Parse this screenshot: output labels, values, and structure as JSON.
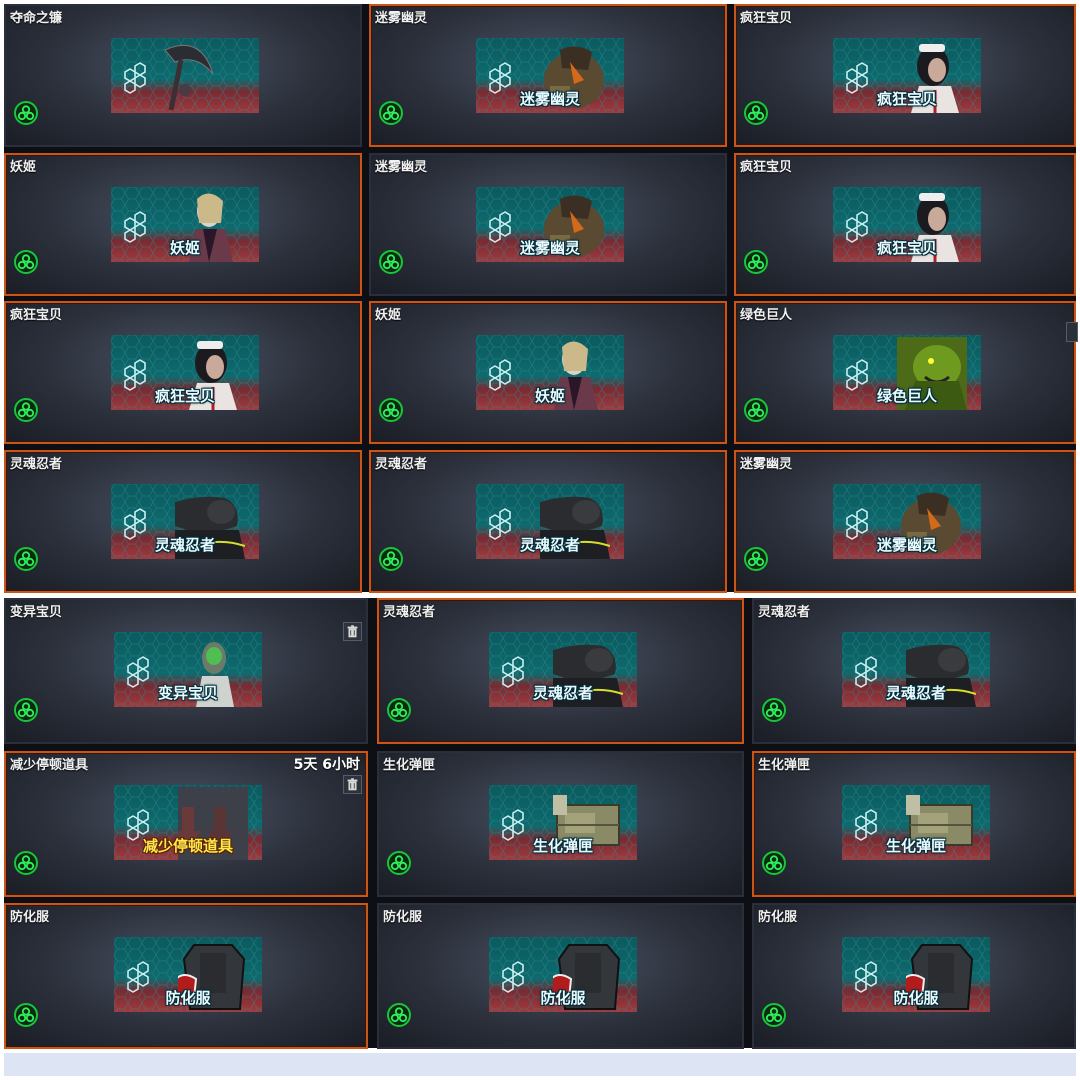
{
  "top_panel": {
    "cards": [
      {
        "title": "夺命之镰",
        "label": "",
        "art": "scythe-art",
        "selected": false
      },
      {
        "title": "迷雾幽灵",
        "label": "迷雾幽灵",
        "art": "mist-ghost-art",
        "selected": true
      },
      {
        "title": "疯狂宝贝",
        "label": "疯狂宝贝",
        "art": "crazy-baby-art",
        "selected": true
      },
      {
        "title": "妖姬",
        "label": "妖姬",
        "art": "demon-lady-art",
        "selected": true
      },
      {
        "title": "迷雾幽灵",
        "label": "迷雾幽灵",
        "art": "mist-ghost-art",
        "selected": false
      },
      {
        "title": "疯狂宝贝",
        "label": "疯狂宝贝",
        "art": "crazy-baby-art",
        "selected": true
      },
      {
        "title": "疯狂宝贝",
        "label": "疯狂宝贝",
        "art": "crazy-baby-art",
        "selected": true
      },
      {
        "title": "妖姬",
        "label": "妖姬",
        "art": "demon-lady-art",
        "selected": true
      },
      {
        "title": "绿色巨人",
        "label": "绿色巨人",
        "art": "green-giant-art",
        "selected": true
      },
      {
        "title": "灵魂忍者",
        "label": "灵魂忍者",
        "art": "soul-ninja-art",
        "selected": true
      },
      {
        "title": "灵魂忍者",
        "label": "灵魂忍者",
        "art": "soul-ninja-art",
        "selected": true
      },
      {
        "title": "迷雾幽灵",
        "label": "迷雾幽灵",
        "art": "mist-ghost-art",
        "selected": true
      }
    ]
  },
  "bottom_panel": {
    "cards": [
      {
        "title": "变异宝贝",
        "label": "变异宝贝",
        "art": "mutant-baby-art",
        "selected": false,
        "trash": true
      },
      {
        "title": "灵魂忍者",
        "label": "灵魂忍者",
        "art": "soul-ninja-art",
        "selected": true
      },
      {
        "title": "灵魂忍者",
        "label": "灵魂忍者",
        "art": "soul-ninja-art",
        "selected": false
      },
      {
        "title": "减少停顿道具",
        "label": "减少停顿道具",
        "art": "reduce-stun-art",
        "selected": true,
        "trash": true,
        "timer": "5天 6小时"
      },
      {
        "title": "生化弹匣",
        "label": "生化弹匣",
        "art": "bio-ammo-box-art",
        "selected": false
      },
      {
        "title": "生化弹匣",
        "label": "生化弹匣",
        "art": "bio-ammo-box-art",
        "selected": true
      },
      {
        "title": "防化服",
        "label": "防化服",
        "art": "hazmat-suit-art",
        "selected": true
      },
      {
        "title": "防化服",
        "label": "防化服",
        "art": "hazmat-suit-art",
        "selected": false
      },
      {
        "title": "防化服",
        "label": "防化服",
        "art": "hazmat-suit-art",
        "selected": false
      }
    ]
  },
  "icons": {
    "zombie_badge": "zombie-mode-icon",
    "trash": "trash-icon"
  },
  "colors": {
    "selected_border": "#c8561a",
    "badge_green": "#19c63a"
  }
}
